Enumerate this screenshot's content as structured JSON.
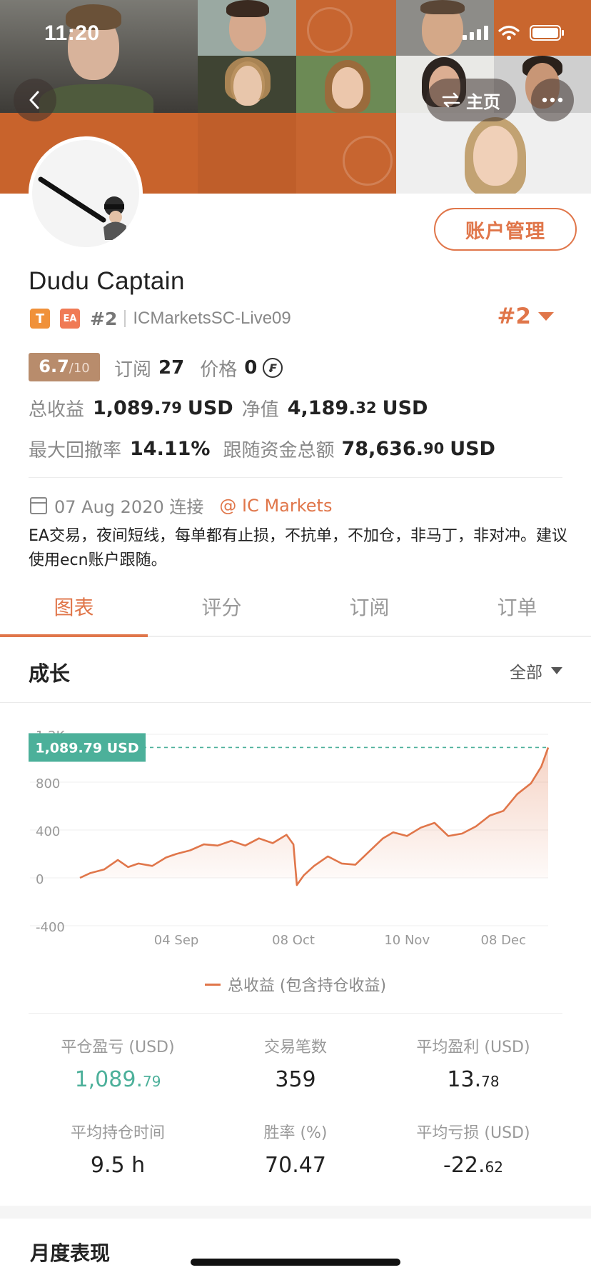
{
  "status_bar": {
    "time": "11:20"
  },
  "nav": {
    "home_label": "主页"
  },
  "profile": {
    "account_manage_label": "账户管理",
    "name": "Dudu Captain",
    "tag_t": "T",
    "tag_ea": "EA",
    "rank_small": "#2",
    "server": "ICMarketsSC-Live09",
    "rank_big": "#2"
  },
  "score": {
    "value": "6.7",
    "max": "/10"
  },
  "subs": {
    "label": "订阅",
    "count": "27",
    "price_label": "价格",
    "price": "0",
    "coin_symbol": "₣"
  },
  "metrics": {
    "total_profit_label": "总收益",
    "total_profit_int": "1,089.",
    "total_profit_dec": "79",
    "total_profit_unit": "USD",
    "equity_label": "净值",
    "equity_int": "4,189.",
    "equity_dec": "32",
    "equity_unit": "USD",
    "drawdown_label": "最大回撤率",
    "drawdown": "14.11%",
    "follow_label": "跟随资金总额",
    "follow_int": "78,636.",
    "follow_dec": "90",
    "follow_unit": "USD"
  },
  "join": {
    "date": "07 Aug 2020 连接",
    "broker": "@ IC Markets"
  },
  "description": "EA交易，夜间短线，每单都有止损，不抗单，不加仓，非马丁，非对冲。建议使用ecn账户跟随。",
  "tabs": [
    "图表",
    "评分",
    "订阅",
    "订单"
  ],
  "section": {
    "title": "成长",
    "filter": "全部"
  },
  "chart_data": {
    "type": "area",
    "y_ticks": [
      "1.2K",
      "800",
      "400",
      "0",
      "-400"
    ],
    "y_tick_values": [
      1200,
      800,
      400,
      0,
      -400
    ],
    "x_ticks": [
      "04 Sep",
      "08 Oct",
      "10 Nov",
      "08 Dec"
    ],
    "ylim": [
      -400,
      1200
    ],
    "current_label": "1,089.79 USD",
    "current_value": 1089.79,
    "series": [
      {
        "name": "总收益 (包含持仓收益)",
        "x": [
          "2020-08-07",
          "2020-08-10",
          "2020-08-14",
          "2020-08-18",
          "2020-08-21",
          "2020-08-24",
          "2020-08-28",
          "2020-09-01",
          "2020-09-04",
          "2020-09-08",
          "2020-09-12",
          "2020-09-16",
          "2020-09-20",
          "2020-09-24",
          "2020-09-28",
          "2020-10-02",
          "2020-10-06",
          "2020-10-08",
          "2020-10-09",
          "2020-10-11",
          "2020-10-14",
          "2020-10-18",
          "2020-10-22",
          "2020-10-26",
          "2020-10-30",
          "2020-11-03",
          "2020-11-06",
          "2020-11-10",
          "2020-11-14",
          "2020-11-18",
          "2020-11-22",
          "2020-11-26",
          "2020-11-30",
          "2020-12-04",
          "2020-12-08",
          "2020-12-12",
          "2020-12-16",
          "2020-12-19",
          "2020-12-21"
        ],
        "values": [
          0,
          40,
          70,
          150,
          90,
          120,
          100,
          170,
          200,
          230,
          280,
          270,
          310,
          270,
          330,
          290,
          360,
          280,
          -60,
          20,
          100,
          180,
          120,
          110,
          220,
          330,
          380,
          350,
          420,
          460,
          350,
          370,
          430,
          520,
          560,
          700,
          790,
          930,
          1089.79
        ]
      }
    ],
    "grid": true
  },
  "legend": {
    "label": "总收益 (包含持仓收益)"
  },
  "stats": [
    {
      "label": "平仓盈亏 (USD)",
      "int": "1,089.",
      "dec": "79",
      "teal": true
    },
    {
      "label": "交易笔数",
      "int": "359",
      "dec": ""
    },
    {
      "label": "平均盈利 (USD)",
      "int": "13.",
      "dec": "78"
    },
    {
      "label": "平均持仓时间",
      "int": "9.5 h",
      "dec": ""
    },
    {
      "label": "胜率 (%)",
      "int": "70.47",
      "dec": ""
    },
    {
      "label": "平均亏损 (USD)",
      "int": "-22.",
      "dec": "62"
    }
  ],
  "monthly": {
    "title": "月度表现"
  },
  "colors": {
    "accent": "#e0764a",
    "teal": "#4cb09a",
    "banner": "#c4622b"
  }
}
